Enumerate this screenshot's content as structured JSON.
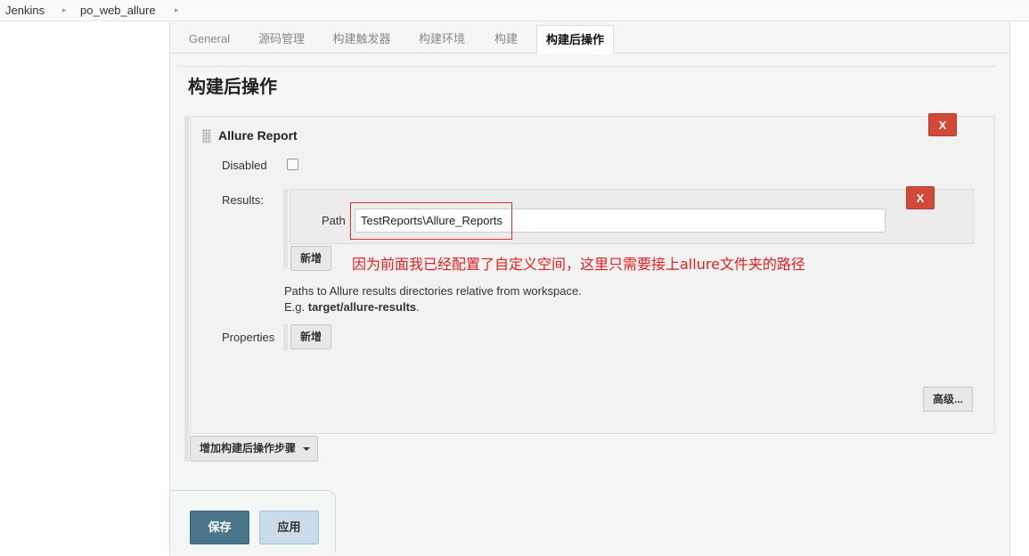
{
  "breadcrumb": {
    "items": [
      "Jenkins",
      "po_web_allure"
    ],
    "separator": "▸"
  },
  "tabs": [
    {
      "label": "General",
      "active": false
    },
    {
      "label": "源码管理",
      "active": false
    },
    {
      "label": "构建触发器",
      "active": false
    },
    {
      "label": "构建环境",
      "active": false
    },
    {
      "label": "构建",
      "active": false
    },
    {
      "label": "构建后操作",
      "active": true
    }
  ],
  "section": {
    "title": "构建后操作"
  },
  "plugin": {
    "title": "Allure Report",
    "delete_label": "X",
    "disabled_label": "Disabled",
    "disabled_checked": false,
    "results_label": "Results:",
    "path_label": "Path",
    "path_value": "TestReports\\Allure_Reports",
    "path_delete_label": "X",
    "results_add_label": "新增",
    "annotation": "因为前面我已经配置了自定义空间，这里只需要接上allure文件夹的路径",
    "help_line1": "Paths to Allure results directories relative from workspace.",
    "help_prefix": "E.g. ",
    "help_example": "target/allure-results",
    "help_suffix": ".",
    "properties_label": "Properties",
    "properties_add_label": "新增",
    "advanced_label": "高级..."
  },
  "add_step_label": "增加构建后操作步骤",
  "footer": {
    "save_label": "保存",
    "apply_label": "应用"
  },
  "colors": {
    "danger": "#d24939",
    "annotation": "#e02020",
    "save": "#4b758b",
    "apply": "#c8dceb"
  },
  "icons": [
    "breadcrumb-arrow-icon",
    "drag-handle-icon",
    "dropdown-caret-icon"
  ]
}
